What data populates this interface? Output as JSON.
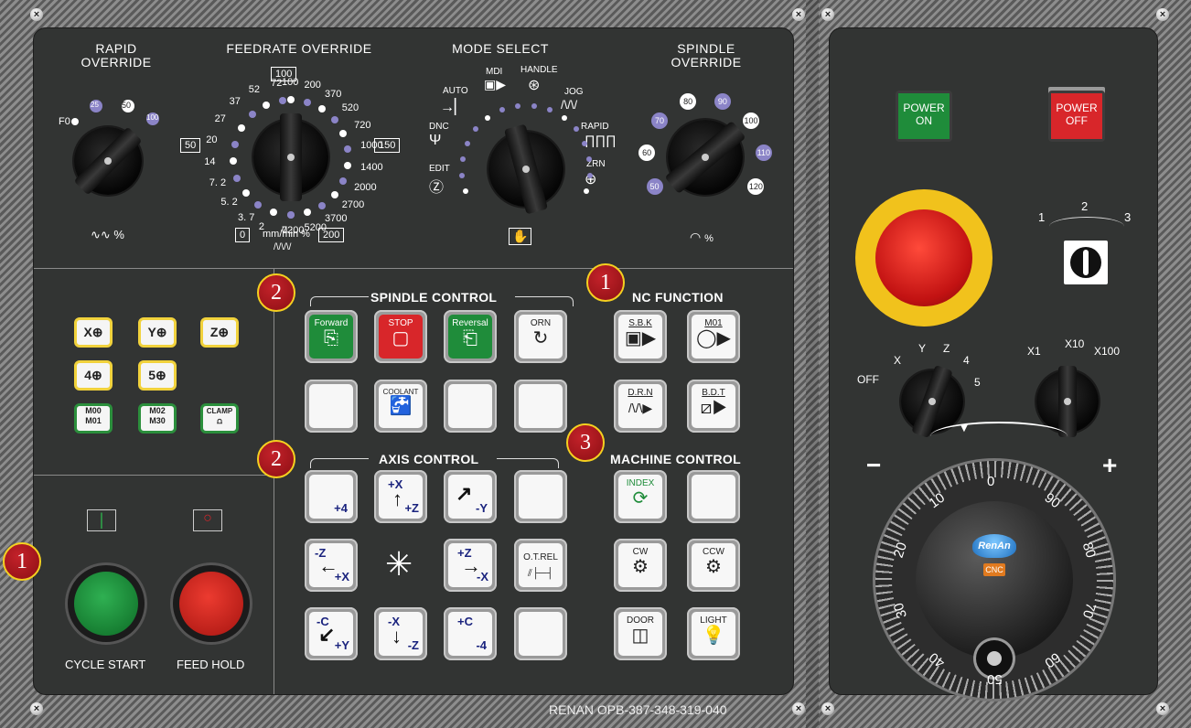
{
  "rapid": {
    "title": "RAPID\nOVERRIDE",
    "stops": [
      "F0",
      "25",
      "50",
      "100"
    ],
    "unit": "%",
    "icon": "rapid-wave-icon"
  },
  "feed": {
    "title": "FEEDRATE OVERRIDE",
    "top_box": "100",
    "left_box": "50",
    "right_box": "150",
    "left_scale": [
      "72",
      "52",
      "37",
      "27",
      "20",
      "14",
      "7. 2",
      "5. 2",
      "3. 7",
      "2",
      "0"
    ],
    "right_scale": [
      "100",
      "200",
      "370",
      "520",
      "720",
      "1000",
      "1400",
      "2000",
      "2700",
      "3700",
      "5200",
      "7200"
    ],
    "bottom_box_left": "0",
    "unit": "mm/min %",
    "bottom_box_right": "200"
  },
  "mode": {
    "title": "MODE SELECT",
    "labels": [
      "AUTO",
      "MDI",
      "HANDLE",
      "JOG",
      "RAPID",
      "ZRN",
      "DNC",
      "EDIT"
    ]
  },
  "spindle_ovr": {
    "title": "SPINDLE\nOVERRIDE",
    "stops": [
      "50",
      "60",
      "70",
      "80",
      "90",
      "100",
      "110",
      "120"
    ],
    "unit": "%"
  },
  "spindle_control": {
    "title": "SPINDLE CONTROL",
    "forward": "Forward",
    "stop": "STOP",
    "reversal": "Reversal",
    "orn": "ORN",
    "coolant": "COOLANT"
  },
  "nc_function": {
    "title": "NC FUNCTION",
    "sbk": "S.B.K",
    "m01": "M01",
    "drn": "D.R.N",
    "bdt": "B.D.T"
  },
  "axis_control": {
    "title": "AXIS CONTROL",
    "plus4": "+4",
    "px": "+X",
    "pz": "+Z",
    "my": "-Y",
    "mz": "-Z",
    "px2": "+X",
    "pz2": "+Z",
    "mx": "-X",
    "otrel": "O.T.REL",
    "mc": "-C",
    "py": "+Y",
    "mx2": "-X",
    "mz2": "-Z",
    "pc": "+C",
    "m4": "-4"
  },
  "machine_control": {
    "title": "MACHINE CONTROL",
    "index": "INDEX",
    "cw": "CW",
    "ccw": "CCW",
    "door": "DOOR",
    "light": "LIGHT"
  },
  "axis_keys": [
    "X",
    "Y",
    "Z",
    "4",
    "5"
  ],
  "m_keys": [
    {
      "top": "M00",
      "bot": "M01"
    },
    {
      "top": "M02",
      "bot": "M30"
    },
    {
      "top": "CLAMP",
      "bot": ""
    }
  ],
  "cycle": {
    "start": "CYCLE START",
    "hold": "FEED HOLD"
  },
  "badges": {
    "b1": "1",
    "b2": "2",
    "b3": "2",
    "b4": "3",
    "b5": "1"
  },
  "power": {
    "on": "POWER\nON",
    "off": "POWER\nOFF"
  },
  "selector": {
    "positions": [
      "1",
      "2",
      "3"
    ]
  },
  "axis_sel": {
    "labels": [
      "OFF",
      "X",
      "Y",
      "Z",
      "4",
      "5"
    ]
  },
  "mult_sel": {
    "labels": [
      "X1",
      "X10",
      "X100"
    ]
  },
  "handwheel": {
    "minus": "−",
    "plus": "+",
    "marks": [
      "0",
      "10",
      "20",
      "30",
      "40",
      "50",
      "60",
      "70",
      "80",
      "90"
    ],
    "brand": "RenAn",
    "sub": "CNC"
  },
  "footer": "RENAN OPB-387-348-319-040",
  "colors": {
    "green": "#1f8c3a",
    "red": "#d8262a",
    "yellow": "#f1d23c",
    "purple": "#8b84c7"
  }
}
